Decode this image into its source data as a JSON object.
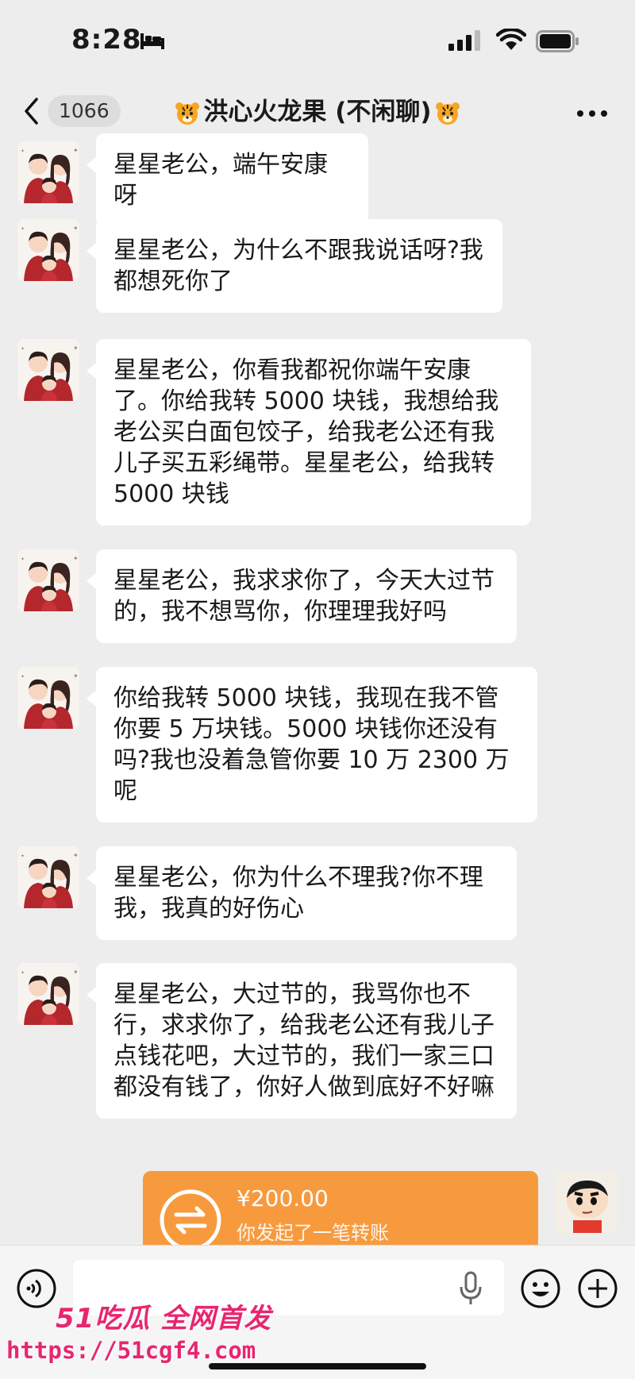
{
  "status_bar": {
    "time": "8:28"
  },
  "nav": {
    "unread_count": "1066",
    "title": "洪心火龙果 (不闲聊)"
  },
  "messages": [
    {
      "text": "星星老公，端午安康呀"
    },
    {
      "text": "星星老公，为什么不跟我说话呀?我都想死你了"
    },
    {
      "text": "星星老公，你看我都祝你端午安康了。你给我转 5000 块钱，我想给我老公买白面包饺子，给我老公还有我儿子买五彩绳带。星星老公，给我转 5000 块钱"
    },
    {
      "text": "星星老公，我求求你了，今天大过节的，我不想骂你，你理理我好吗"
    },
    {
      "text": "你给我转 5000 块钱，我现在我不管你要 5 万块钱。5000 块钱你还没有吗?我也没着急管你要 10 万 2300 万呢"
    },
    {
      "text": "星星老公，你为什么不理我?你不理我，我真的好伤心"
    },
    {
      "text": "星星老公，大过节的，我骂你也不行，求求你了，给我老公还有我儿子点钱花吧，大过节的，我们一家三口都没有钱了，你好人做到底好不好嘛"
    }
  ],
  "transfer": {
    "amount": "¥200.00",
    "description": "你发起了一笔转账"
  },
  "watermark": {
    "brand": "51吃瓜 全网首发",
    "url": "https://51cgf4.com"
  },
  "colors": {
    "background": "#ededed",
    "bubble": "#ffffff",
    "transfer": "#f79a3e",
    "watermark": "#e8266f"
  }
}
